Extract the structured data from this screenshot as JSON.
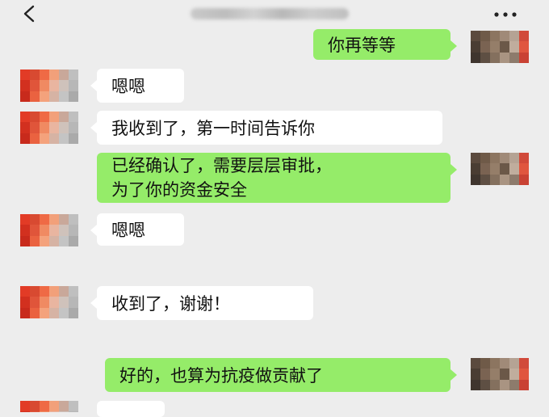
{
  "header": {
    "back_icon": "chevron-left-icon",
    "contact_name_blurred": true,
    "more_icon": "more-dots-icon"
  },
  "messages": [
    {
      "side": "right",
      "lines": [
        "你再等等"
      ]
    },
    {
      "side": "left",
      "lines": [
        "嗯嗯"
      ]
    },
    {
      "side": "left",
      "lines": [
        "我收到了，第一时间告诉你"
      ]
    },
    {
      "side": "right",
      "lines": [
        "已经确认了，需要层层审批，",
        "为了你的资金安全"
      ]
    },
    {
      "side": "left",
      "lines": [
        "嗯嗯"
      ]
    },
    {
      "side": "left",
      "lines": [
        "收到了，谢谢！"
      ]
    },
    {
      "side": "right",
      "lines": [
        "好的，也算为抗疫做贡献了"
      ]
    }
  ],
  "colors": {
    "background": "#ededed",
    "outgoing_bubble": "#95ec69",
    "incoming_bubble": "#ffffff",
    "text": "#111111"
  }
}
